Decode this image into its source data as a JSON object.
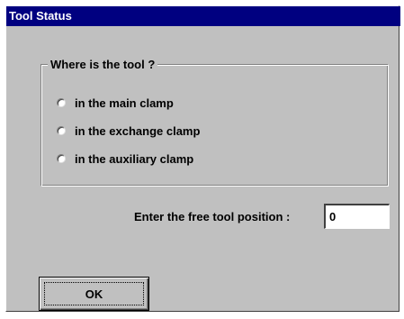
{
  "window": {
    "title": "Tool Status"
  },
  "group": {
    "legend": "Where is the tool ?",
    "options": [
      {
        "label": "in the main clamp",
        "selected": false
      },
      {
        "label": "in the exchange clamp",
        "selected": false
      },
      {
        "label": "in the auxiliary clamp",
        "selected": false
      }
    ]
  },
  "free_position": {
    "label": "Enter the free tool position :",
    "value": "0"
  },
  "buttons": {
    "ok_label": "OK"
  },
  "colors": {
    "titlebar": "#000080",
    "dialog_face": "#c0c0c0"
  }
}
